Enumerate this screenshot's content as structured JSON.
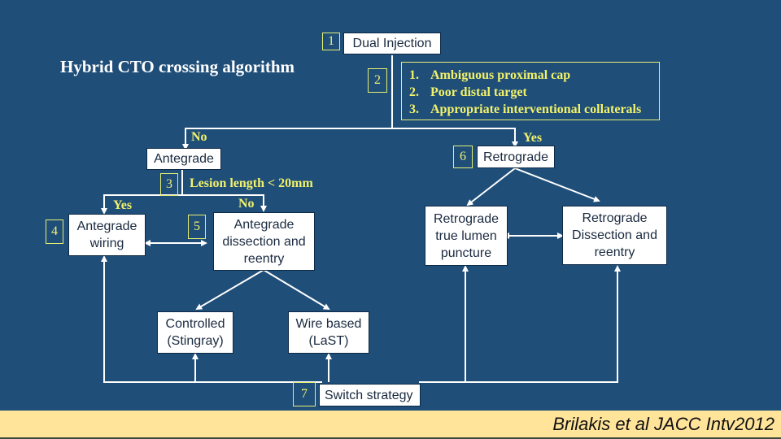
{
  "title": "Hybrid CTO crossing algorithm",
  "colors": {
    "background": "#1f4e79",
    "box_fill": "#ffffff",
    "box_text": "#1a2a40",
    "highlight_text": "#f2f26a",
    "footer": "#ffe49a"
  },
  "steps": {
    "s1": {
      "num": "1",
      "label": "Dual Injection"
    },
    "s2": {
      "num": "2",
      "criteria": [
        {
          "n": "1.",
          "text": "Ambiguous proximal cap"
        },
        {
          "n": "2.",
          "text": "Poor distal target"
        },
        {
          "n": "3.",
          "text": "Appropriate interventional collaterals"
        }
      ]
    },
    "s3": {
      "num": "3",
      "question": "Lesion length < 20mm"
    },
    "s4": {
      "num": "4",
      "label": "Antegrade\nwiring"
    },
    "s5": {
      "num": "5",
      "label": "Antegrade\ndissection and\nreentry"
    },
    "s6": {
      "num": "6",
      "label": "Retrograde"
    },
    "s7": {
      "num": "7",
      "label": "Switch strategy"
    }
  },
  "nodes": {
    "antegrade": "Antegrade",
    "controlled": "Controlled\n(Stingray)",
    "wire_based": "Wire based\n(LaST)",
    "retro_true_lumen": "Retrograde\ntrue lumen\npuncture",
    "retro_dissection": "Retrograde\nDissection and\nreentry"
  },
  "edge_labels": {
    "no_top": "No",
    "yes_top": "Yes",
    "yes_left": "Yes",
    "no_mid": "No"
  },
  "citation": "Brilakis et al JACC Intv2012"
}
